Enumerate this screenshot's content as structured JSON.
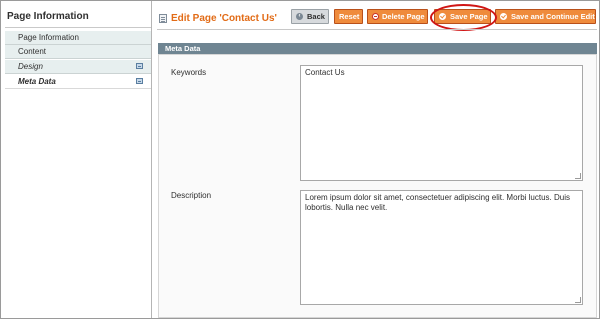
{
  "sidebar": {
    "title": "Page Information",
    "items": [
      {
        "label": "Page Information",
        "has_icon": false
      },
      {
        "label": "Content",
        "has_icon": false
      },
      {
        "label": "Design",
        "has_icon": true
      },
      {
        "label": "Meta Data",
        "has_icon": true
      }
    ],
    "active_item": "Meta Data",
    "item_icon": "changed-indicator-icon"
  },
  "header": {
    "title": "Edit Page 'Contact Us'",
    "title_icon": "page-icon",
    "title_color": "#e26b16"
  },
  "toolbar": {
    "back_label": "Back",
    "reset_label": "Reset",
    "delete_label": "Delete Page",
    "save_label": "Save Page",
    "save_continue_label": "Save and Continue Edit",
    "button_color": "#ef8b3c",
    "highlighted_button": "Save Page",
    "highlight_color": "#d01515"
  },
  "meta": {
    "section_title": "Meta Data",
    "keywords_label": "Keywords",
    "keywords_value": "Contact Us",
    "description_label": "Description",
    "description_value": "Lorem ipsum dolor sit amet, consectetuer adipiscing elit. Morbi luctus. Duis lobortis. Nulla nec velit."
  }
}
